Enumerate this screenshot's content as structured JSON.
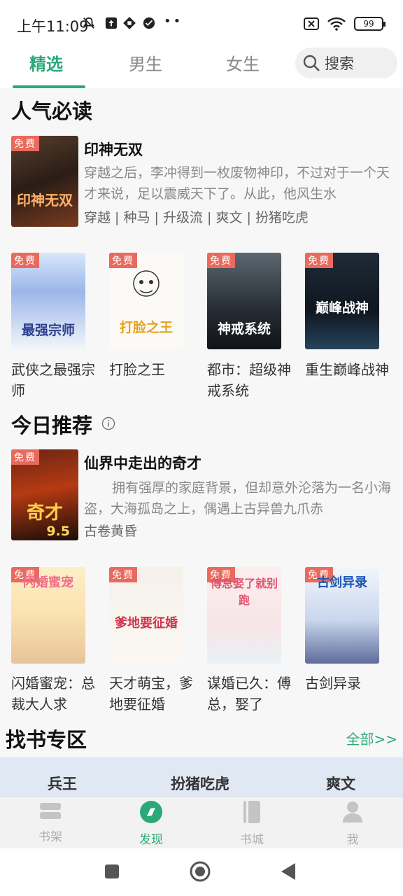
{
  "status": {
    "time": "上午11:09",
    "battery": "99"
  },
  "tabs": [
    {
      "label": "精选",
      "active": true
    },
    {
      "label": "男生",
      "active": false
    },
    {
      "label": "女生",
      "active": false
    }
  ],
  "search": {
    "label": "搜索"
  },
  "free_badge": "免费",
  "popular": {
    "title": "人气必读",
    "feature": {
      "cover_text": "印神无双",
      "title": "印神无双",
      "desc": "穿越之后，李冲得到一枚废物神印，不过对于一个天才来说，足以震威天下了。从此，他风生水",
      "tags": "穿越 | 种马 | 升级流 | 爽文 | 扮猪吃虎"
    },
    "books": [
      {
        "name": "武侠之最强宗师",
        "cover_text": "最强宗师"
      },
      {
        "name": "打脸之王",
        "cover_text": "打脸之王"
      },
      {
        "name": "都市：超级神戒系统",
        "cover_text": "神戒系统"
      },
      {
        "name": "重生巅峰战神",
        "cover_text": "巅峰战神"
      }
    ]
  },
  "today": {
    "title": "今日推荐",
    "feature": {
      "cover_text": "奇才",
      "score": "9.5",
      "title": "仙界中走出的奇才",
      "desc": "拥有强厚的家庭背景，但却意外沦落为一名小海盗，大海孤岛之上，偶遇上古异兽九爪赤",
      "tags": "古卷黄昏"
    },
    "books": [
      {
        "name": "闪婚蜜宠：总裁大人求",
        "cover_text": "闪婚蜜宠"
      },
      {
        "name": "天才萌宝，爹地要征婚",
        "cover_text": "爹地要征婚"
      },
      {
        "name": "谋婚已久：傅总，娶了",
        "cover_text": "傅总娶了就别跑"
      },
      {
        "name": "古剑异录",
        "cover_text": "古剑异录"
      }
    ]
  },
  "find": {
    "title": "找书专区",
    "all": "全部>>"
  },
  "categories": [
    "兵王",
    "扮猪吃虎",
    "爽文"
  ],
  "bottom_nav": [
    {
      "label": "书架",
      "icon": "bookshelf-icon",
      "active": false
    },
    {
      "label": "发现",
      "icon": "compass-icon",
      "active": true
    },
    {
      "label": "书城",
      "icon": "book-icon",
      "active": false
    },
    {
      "label": "我",
      "icon": "user-icon",
      "active": false
    }
  ],
  "colors": {
    "accent": "#2aa878",
    "free_badge": "#e96a5d"
  }
}
